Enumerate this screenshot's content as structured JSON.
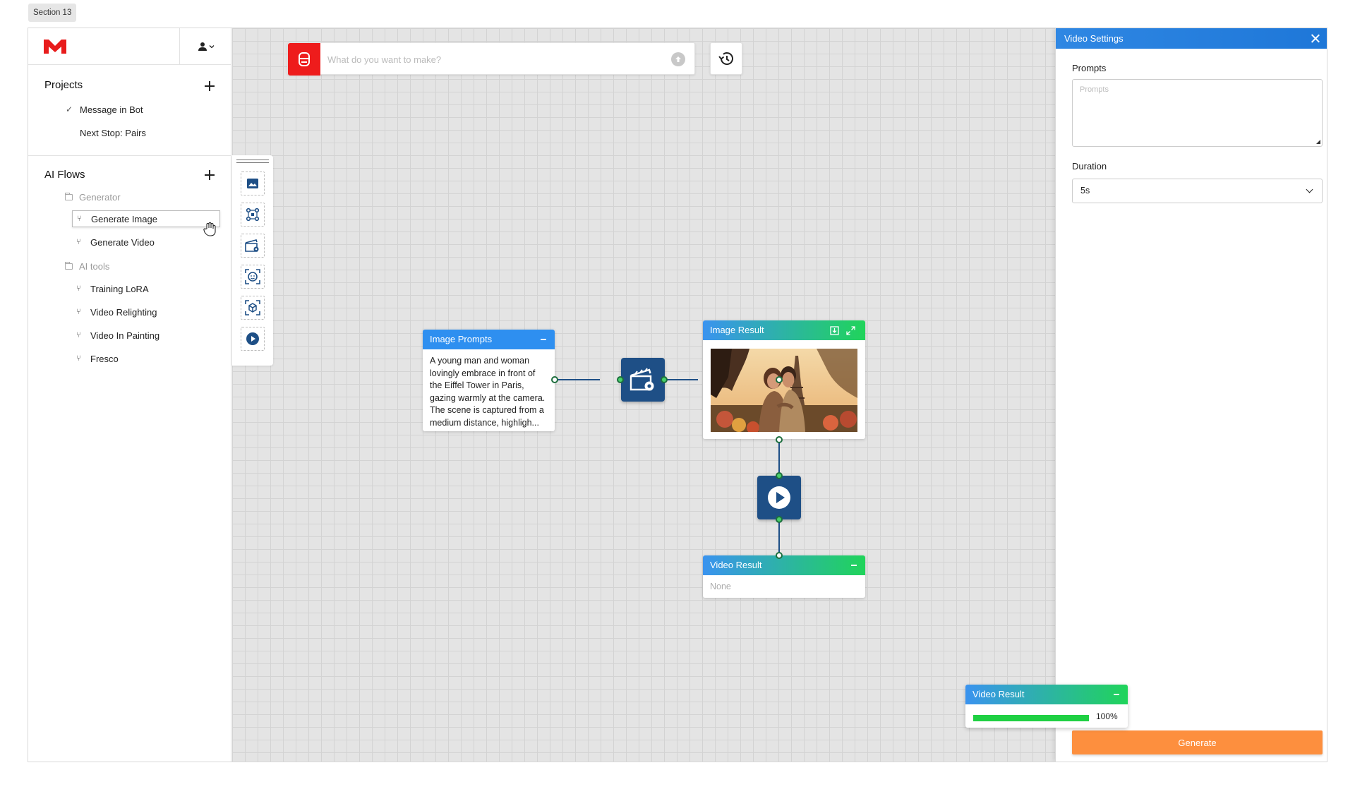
{
  "section_label": "Section 13",
  "sidebar": {
    "projects_title": "Projects",
    "projects": [
      {
        "label": "Message in Bot",
        "selected": true
      },
      {
        "label": "Next Stop: Pairs",
        "selected": false
      }
    ],
    "ai_flows_title": "AI Flows",
    "folders": [
      {
        "label": "Generator",
        "items": [
          "Generate Image",
          "Generate Video"
        ]
      },
      {
        "label": "AI tools",
        "items": [
          "Training LoRA",
          "Video Relighting",
          "Video In Painting",
          "Fresco"
        ]
      }
    ],
    "active_item": "Generate Image",
    "brand_color": "#e81c1c"
  },
  "canvas": {
    "prompt_placeholder": "What do you want to make?",
    "tool_icons": [
      "image-icon",
      "nodes-icon",
      "video-settings-icon",
      "face-icon",
      "cube-icon",
      "play-icon"
    ],
    "nodes": {
      "image_prompts": {
        "title": "Image Prompts",
        "text": "A young man and woman lovingly embrace in front of the Eiffel Tower in Paris, gazing warmly at the camera. The scene is captured from a medium distance, highligh..."
      },
      "image_result": {
        "title": "Image Result"
      },
      "video_result": {
        "title": "Video Result",
        "value": "None"
      }
    }
  },
  "panel": {
    "title": "Video Settings",
    "prompts_label": "Prompts",
    "prompts_placeholder": "Prompts",
    "duration_label": "Duration",
    "duration_value": "5s",
    "generate_label": "Generate",
    "generate_color": "#fd8f3e"
  },
  "float_result": {
    "title": "Video Result",
    "progress": 1.0,
    "progress_label": "100%"
  }
}
